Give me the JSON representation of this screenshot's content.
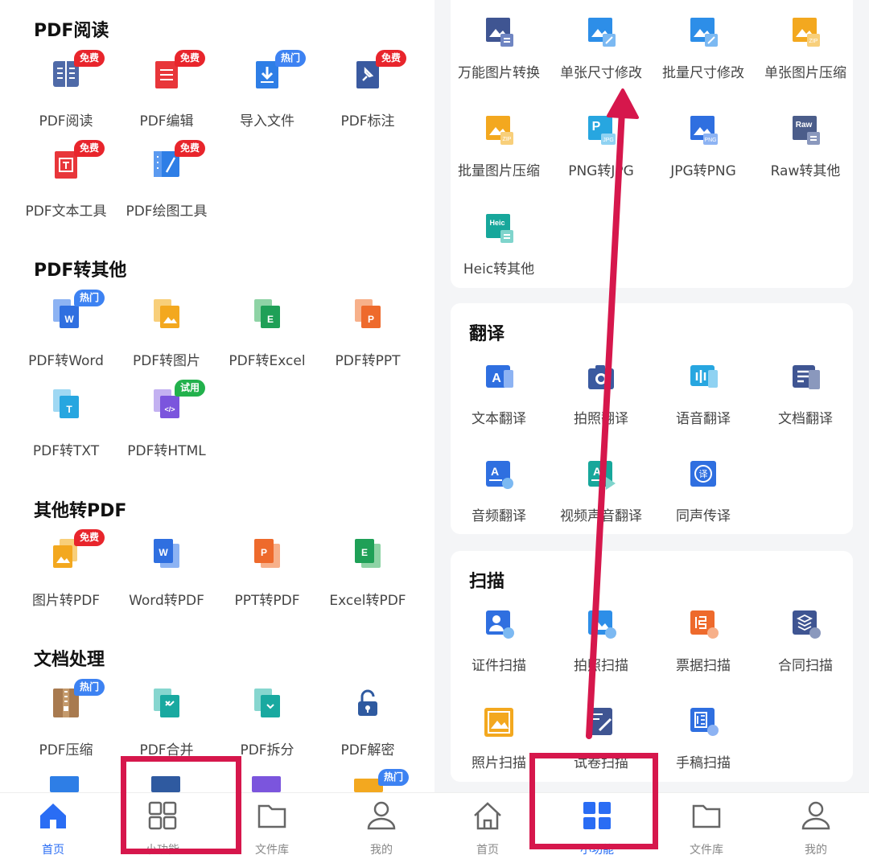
{
  "colors": {
    "accent": "#2a6df4",
    "annotation": "#d6174c",
    "badge_red": "#e8252c",
    "badge_blue": "#3d82f2",
    "badge_green": "#22b14c"
  },
  "left": {
    "sections": [
      {
        "title": "PDF阅读",
        "items": [
          {
            "label": "PDF阅读",
            "icon": "book-icon",
            "badge": "免费"
          },
          {
            "label": "PDF编辑",
            "icon": "edit-doc-icon",
            "badge": "免费"
          },
          {
            "label": "导入文件",
            "icon": "import-icon",
            "badge": "热门"
          },
          {
            "label": "PDF标注",
            "icon": "pin-icon",
            "badge": "免费"
          },
          {
            "label": "PDF文本工具",
            "icon": "text-tool-icon",
            "badge": "免费"
          },
          {
            "label": "PDF绘图工具",
            "icon": "draw-tool-icon",
            "badge": "免费"
          }
        ]
      },
      {
        "title": "PDF转其他",
        "items": [
          {
            "label": "PDF转Word",
            "icon": "pdf-to-word-icon",
            "badge": "热门"
          },
          {
            "label": "PDF转图片",
            "icon": "pdf-to-image-icon",
            "badge": ""
          },
          {
            "label": "PDF转Excel",
            "icon": "pdf-to-excel-icon",
            "badge": ""
          },
          {
            "label": "PDF转PPT",
            "icon": "pdf-to-ppt-icon",
            "badge": ""
          },
          {
            "label": "PDF转TXT",
            "icon": "pdf-to-txt-icon",
            "badge": ""
          },
          {
            "label": "PDF转HTML",
            "icon": "pdf-to-html-icon",
            "badge": "试用"
          }
        ]
      },
      {
        "title": "其他转PDF",
        "items": [
          {
            "label": "图片转PDF",
            "icon": "image-to-pdf-icon",
            "badge": "免费"
          },
          {
            "label": "Word转PDF",
            "icon": "word-to-pdf-icon",
            "badge": ""
          },
          {
            "label": "PPT转PDF",
            "icon": "ppt-to-pdf-icon",
            "badge": ""
          },
          {
            "label": "Excel转PDF",
            "icon": "excel-to-pdf-icon",
            "badge": ""
          }
        ]
      },
      {
        "title": "文档处理",
        "items": [
          {
            "label": "PDF压缩",
            "icon": "zip-icon",
            "badge": "热门"
          },
          {
            "label": "PDF合并",
            "icon": "merge-icon",
            "badge": ""
          },
          {
            "label": "PDF拆分",
            "icon": "split-icon",
            "badge": ""
          },
          {
            "label": "PDF解密",
            "icon": "unlock-icon",
            "badge": ""
          }
        ]
      }
    ],
    "partial_row_badge": "热门",
    "tabs": [
      {
        "label": "首页",
        "icon": "home-icon"
      },
      {
        "label": "小功能",
        "icon": "grid-icon"
      },
      {
        "label": "文件库",
        "icon": "folder-icon"
      },
      {
        "label": "我的",
        "icon": "person-icon"
      }
    ]
  },
  "right": {
    "image_tools": [
      {
        "label": "万能图片转换",
        "icon": "image-convert-icon"
      },
      {
        "label": "单张尺寸修改",
        "icon": "image-resize-icon"
      },
      {
        "label": "批量尺寸修改",
        "icon": "batch-resize-icon"
      },
      {
        "label": "单张图片压缩",
        "icon": "image-zip-icon"
      },
      {
        "label": "批量图片压缩",
        "icon": "batch-zip-icon"
      },
      {
        "label": "PNG转JPG",
        "icon": "png-to-jpg-icon"
      },
      {
        "label": "JPG转PNG",
        "icon": "jpg-to-png-icon"
      },
      {
        "label": "Raw转其他",
        "icon": "raw-icon"
      },
      {
        "label": "Heic转其他",
        "icon": "heic-icon"
      }
    ],
    "translate": {
      "title": "翻译",
      "items": [
        {
          "label": "文本翻译",
          "icon": "text-translate-icon"
        },
        {
          "label": "拍照翻译",
          "icon": "camera-translate-icon"
        },
        {
          "label": "语音翻译",
          "icon": "voice-translate-icon"
        },
        {
          "label": "文档翻译",
          "icon": "doc-translate-icon"
        },
        {
          "label": "音频翻译",
          "icon": "audio-translate-icon"
        },
        {
          "label": "视频声音翻译",
          "icon": "video-translate-icon"
        },
        {
          "label": "同声传译",
          "icon": "simul-translate-icon"
        }
      ]
    },
    "scan": {
      "title": "扫描",
      "items": [
        {
          "label": "证件扫描",
          "icon": "id-scan-icon"
        },
        {
          "label": "拍照扫描",
          "icon": "photo-scan-icon"
        },
        {
          "label": "票据扫描",
          "icon": "receipt-scan-icon"
        },
        {
          "label": "合同扫描",
          "icon": "contract-scan-icon"
        },
        {
          "label": "照片扫描",
          "icon": "picture-scan-icon"
        },
        {
          "label": "试卷扫描",
          "icon": "exam-scan-icon"
        },
        {
          "label": "手稿扫描",
          "icon": "manuscript-scan-icon"
        }
      ]
    },
    "tabs": [
      {
        "label": "首页",
        "icon": "home-icon"
      },
      {
        "label": "小功能",
        "icon": "grid-icon"
      },
      {
        "label": "文件库",
        "icon": "folder-icon"
      },
      {
        "label": "我的",
        "icon": "person-icon"
      }
    ]
  }
}
